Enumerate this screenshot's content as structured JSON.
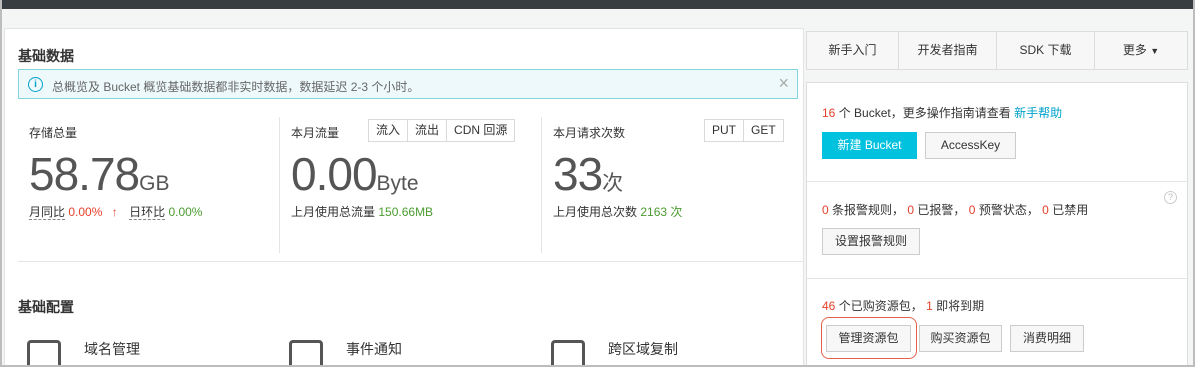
{
  "basic_data": {
    "title": "基础数据",
    "notice": "总概览及 Bucket 概览基础数据都非实时数据，数据延迟 2-3 个小时。",
    "storage": {
      "label": "存储总量",
      "value": "58.78",
      "unit": "GB",
      "mom_label": "月同比",
      "mom_value": "0.00%",
      "dod_label": "日环比",
      "dod_value": "0.00%"
    },
    "traffic": {
      "label": "本月流量",
      "tabs": [
        "流入",
        "流出",
        "CDN 回源"
      ],
      "value": "0.00",
      "unit": "Byte",
      "last_month_label": "上月使用总流量",
      "last_month_value": "150.66MB"
    },
    "requests": {
      "label": "本月请求次数",
      "tabs": [
        "PUT",
        "GET"
      ],
      "value": "33",
      "unit": "次",
      "last_month_label": "上月使用总次数",
      "last_month_value": "2163 次"
    }
  },
  "basic_config": {
    "title": "基础配置",
    "items": [
      {
        "label": "域名管理",
        "icon": "domain-icon"
      },
      {
        "label": "事件通知",
        "icon": "notification-icon"
      },
      {
        "label": "跨区域复制",
        "icon": "replication-icon"
      }
    ]
  },
  "right_tabs": [
    "新手入门",
    "开发者指南",
    "SDK 下载",
    "更多"
  ],
  "bucket_section": {
    "count": "16",
    "text": "个 Bucket，更多操作指南请查看",
    "help_link": "新手帮助",
    "new_bucket_button": "新建 Bucket",
    "accesskey_button": "AccessKey"
  },
  "alarm_section": {
    "rules_count": "0",
    "rules_label": "条报警规则，",
    "alarmed_count": "0",
    "alarmed_label": "已报警，",
    "alarm_state_count": "0",
    "alarm_state_label": "预警状态，",
    "disabled_count": "0",
    "disabled_label": "已禁用",
    "setup_button": "设置报警规则"
  },
  "package_section": {
    "count": "46",
    "text": "个已购资源包，",
    "expiring_count": "1",
    "expiring_label": "即将到期",
    "manage_button": "管理资源包",
    "buy_button": "购买资源包",
    "details_button": "消费明细"
  },
  "colors": {
    "accent": "#00c1de",
    "link": "#00a2ca",
    "warning_red": "#e5412b",
    "success_green": "#4b9b31"
  }
}
